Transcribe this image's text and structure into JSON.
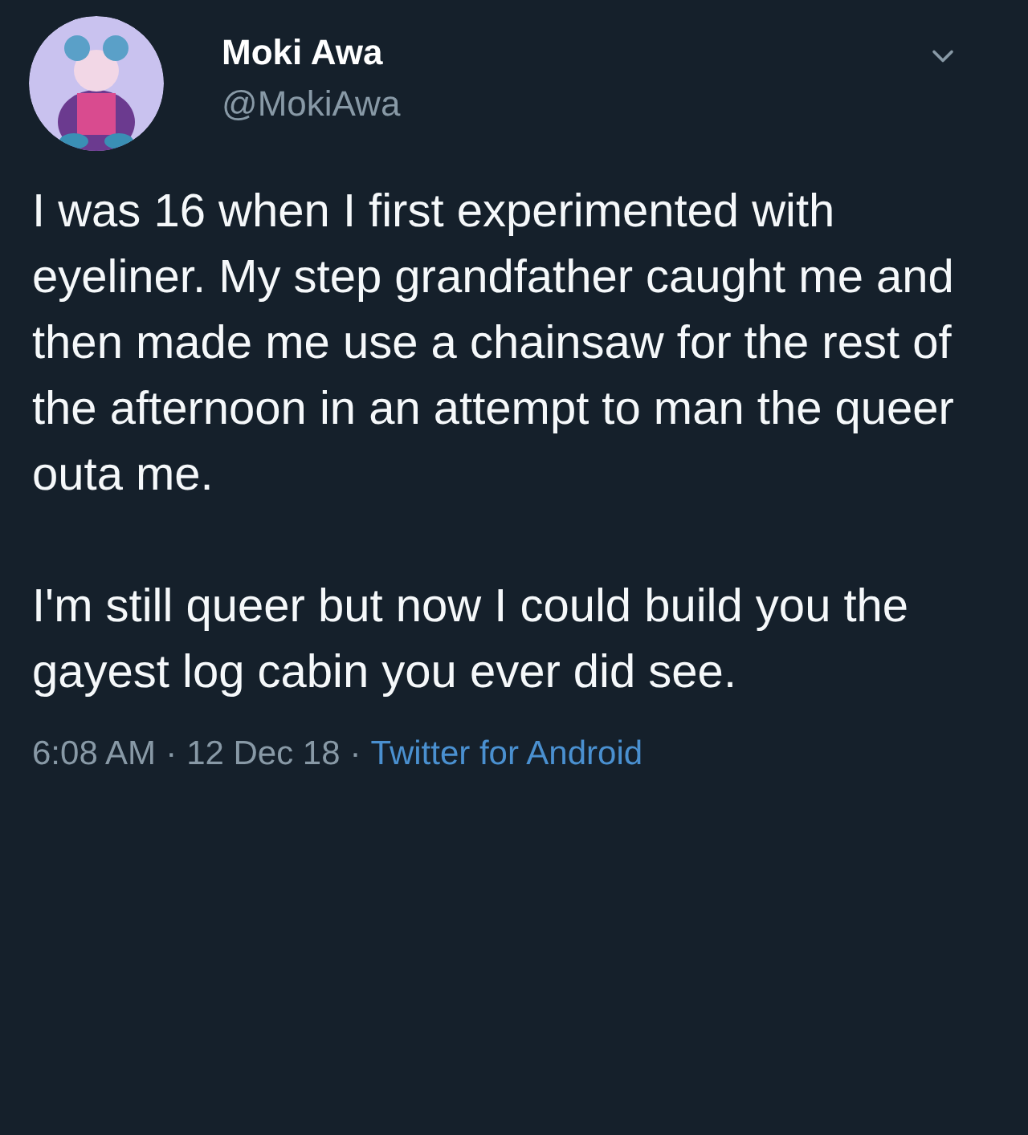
{
  "author": {
    "name": "Moki Awa",
    "handle": "@MokiAwa"
  },
  "tweet": {
    "paragraphs": [
      "I was 16 when I first experimented with eyeliner.  My step grandfather caught me and then made me use a chainsaw for the rest of the afternoon in an attempt to man the queer outa me.",
      "I'm still queer but now I could build you the gayest log cabin you ever did see."
    ]
  },
  "meta": {
    "time": "6:08 AM",
    "separator_1": "·",
    "date": "12 Dec 18",
    "separator_2": "·",
    "source": "Twitter for Android"
  }
}
